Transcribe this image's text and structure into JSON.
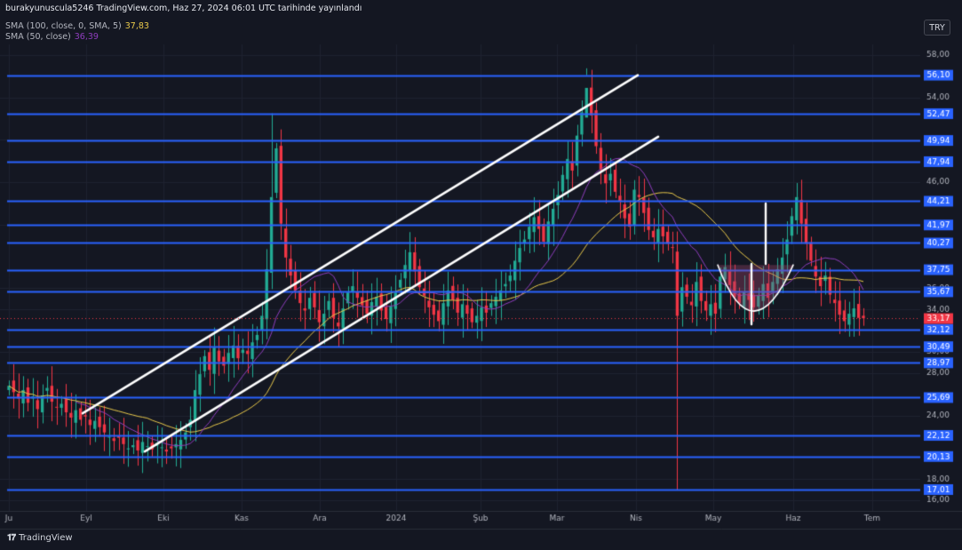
{
  "header": {
    "title": "burakyunuscula5246 TradingView.com, Haz 27, 2024 06:01 UTC tarihinde yayınlandı",
    "sma100_label": "SMA (100, close, 0, SMA, 5)",
    "sma100_value": "37,83",
    "sma50_label": "SMA (50, close)",
    "sma50_value": "36,39"
  },
  "currency": "TRY",
  "brand": "TradingView",
  "chart_data": {
    "type": "candlestick",
    "title": "",
    "xlabel": "",
    "ylabel": "",
    "ylim": [
      15,
      59
    ],
    "price_ticks": [
      "58,00",
      "54,00",
      "50,00",
      "46,00",
      "42,00",
      "36,00",
      "34,00",
      "30,00",
      "28,00",
      "24,00",
      "18,00",
      "16,00"
    ],
    "month_labels": [
      "Ju",
      "Eyl",
      "Eki",
      "Kas",
      "Ara",
      "2024",
      "Şub",
      "Mar",
      "Nis",
      "May",
      "Haz",
      "Tem"
    ],
    "current_price": "33,17",
    "horizontal_levels": [
      "56,10",
      "52,47",
      "49,94",
      "47,94",
      "44,21",
      "41,97",
      "40,27",
      "37,75",
      "35,67",
      "32,12",
      "30,49",
      "28,97",
      "25,69",
      "22,12",
      "20,13",
      "17,01"
    ],
    "colors": {
      "background": "#141722",
      "up": "#22ab94",
      "down": "#f23645",
      "level": "#2962ff",
      "sma100": "#e8c84a",
      "sma50": "#8e3dbd",
      "channel": "#ffffff",
      "current": "#f23645"
    },
    "closes": [
      26.8,
      26.2,
      25.6,
      26.4,
      25.2,
      25.8,
      24.6,
      25.9,
      26.6,
      25.3,
      24.8,
      25.1,
      24.3,
      23.8,
      24.5,
      23.6,
      23.9,
      23.1,
      23.5,
      22.9,
      22.4,
      22.0,
      21.6,
      21.9,
      21.3,
      20.9,
      21.2,
      20.7,
      21.5,
      21.1,
      20.8,
      21.4,
      21.0,
      20.6,
      20.9,
      21.3,
      21.7,
      22.4,
      23.6,
      26.4,
      27.9,
      29.6,
      28.3,
      30.4,
      29.1,
      28.7,
      29.9,
      30.6,
      29.4,
      30.2,
      29.8,
      30.9,
      31.6,
      33.4,
      37.8,
      44.6,
      49.2,
      42.1,
      38.9,
      37.2,
      35.8,
      34.6,
      33.9,
      35.1,
      34.2,
      32.8,
      33.6,
      34.8,
      33.2,
      32.4,
      34.1,
      35.6,
      36.2,
      35.1,
      34.4,
      33.6,
      34.7,
      35.2,
      33.9,
      33.1,
      34.3,
      35.6,
      36.8,
      38.2,
      39.4,
      37.6,
      36.1,
      35.3,
      34.2,
      33.5,
      32.9,
      34.6,
      35.8,
      34.9,
      33.7,
      34.5,
      33.6,
      32.8,
      33.4,
      34.2,
      33.7,
      34.6,
      35.2,
      35.8,
      36.4,
      37.2,
      38.6,
      39.8,
      40.6,
      41.8,
      42.7,
      41.6,
      40.4,
      42.3,
      43.5,
      44.8,
      46.7,
      48.2,
      47.1,
      50.4,
      52.6,
      54.9,
      52.3,
      49.4,
      47.2,
      45.9,
      46.8,
      45.1,
      44.2,
      42.6,
      41.8,
      45.3,
      44.6,
      43.1,
      41.5,
      40.8,
      41.6,
      40.9,
      40.2,
      39.8,
      33.4,
      36.1,
      35.2,
      34.4,
      36.6,
      34.8,
      33.9,
      34.5,
      33.6,
      37.1,
      38.0,
      36.3,
      35.2,
      34.6,
      35.7,
      34.9,
      34.2,
      35.3,
      36.4,
      35.1,
      36.6,
      37.8,
      38.9,
      40.6,
      42.8,
      44.6,
      42.1,
      40.2,
      38.6,
      37.1,
      36.2,
      37.2,
      35.4,
      34.6,
      33.5,
      32.9,
      33.6,
      34.1,
      33.2,
      33.17
    ],
    "overlays": [
      "channel_upper",
      "channel_lower",
      "cup",
      "target_arrow"
    ]
  }
}
